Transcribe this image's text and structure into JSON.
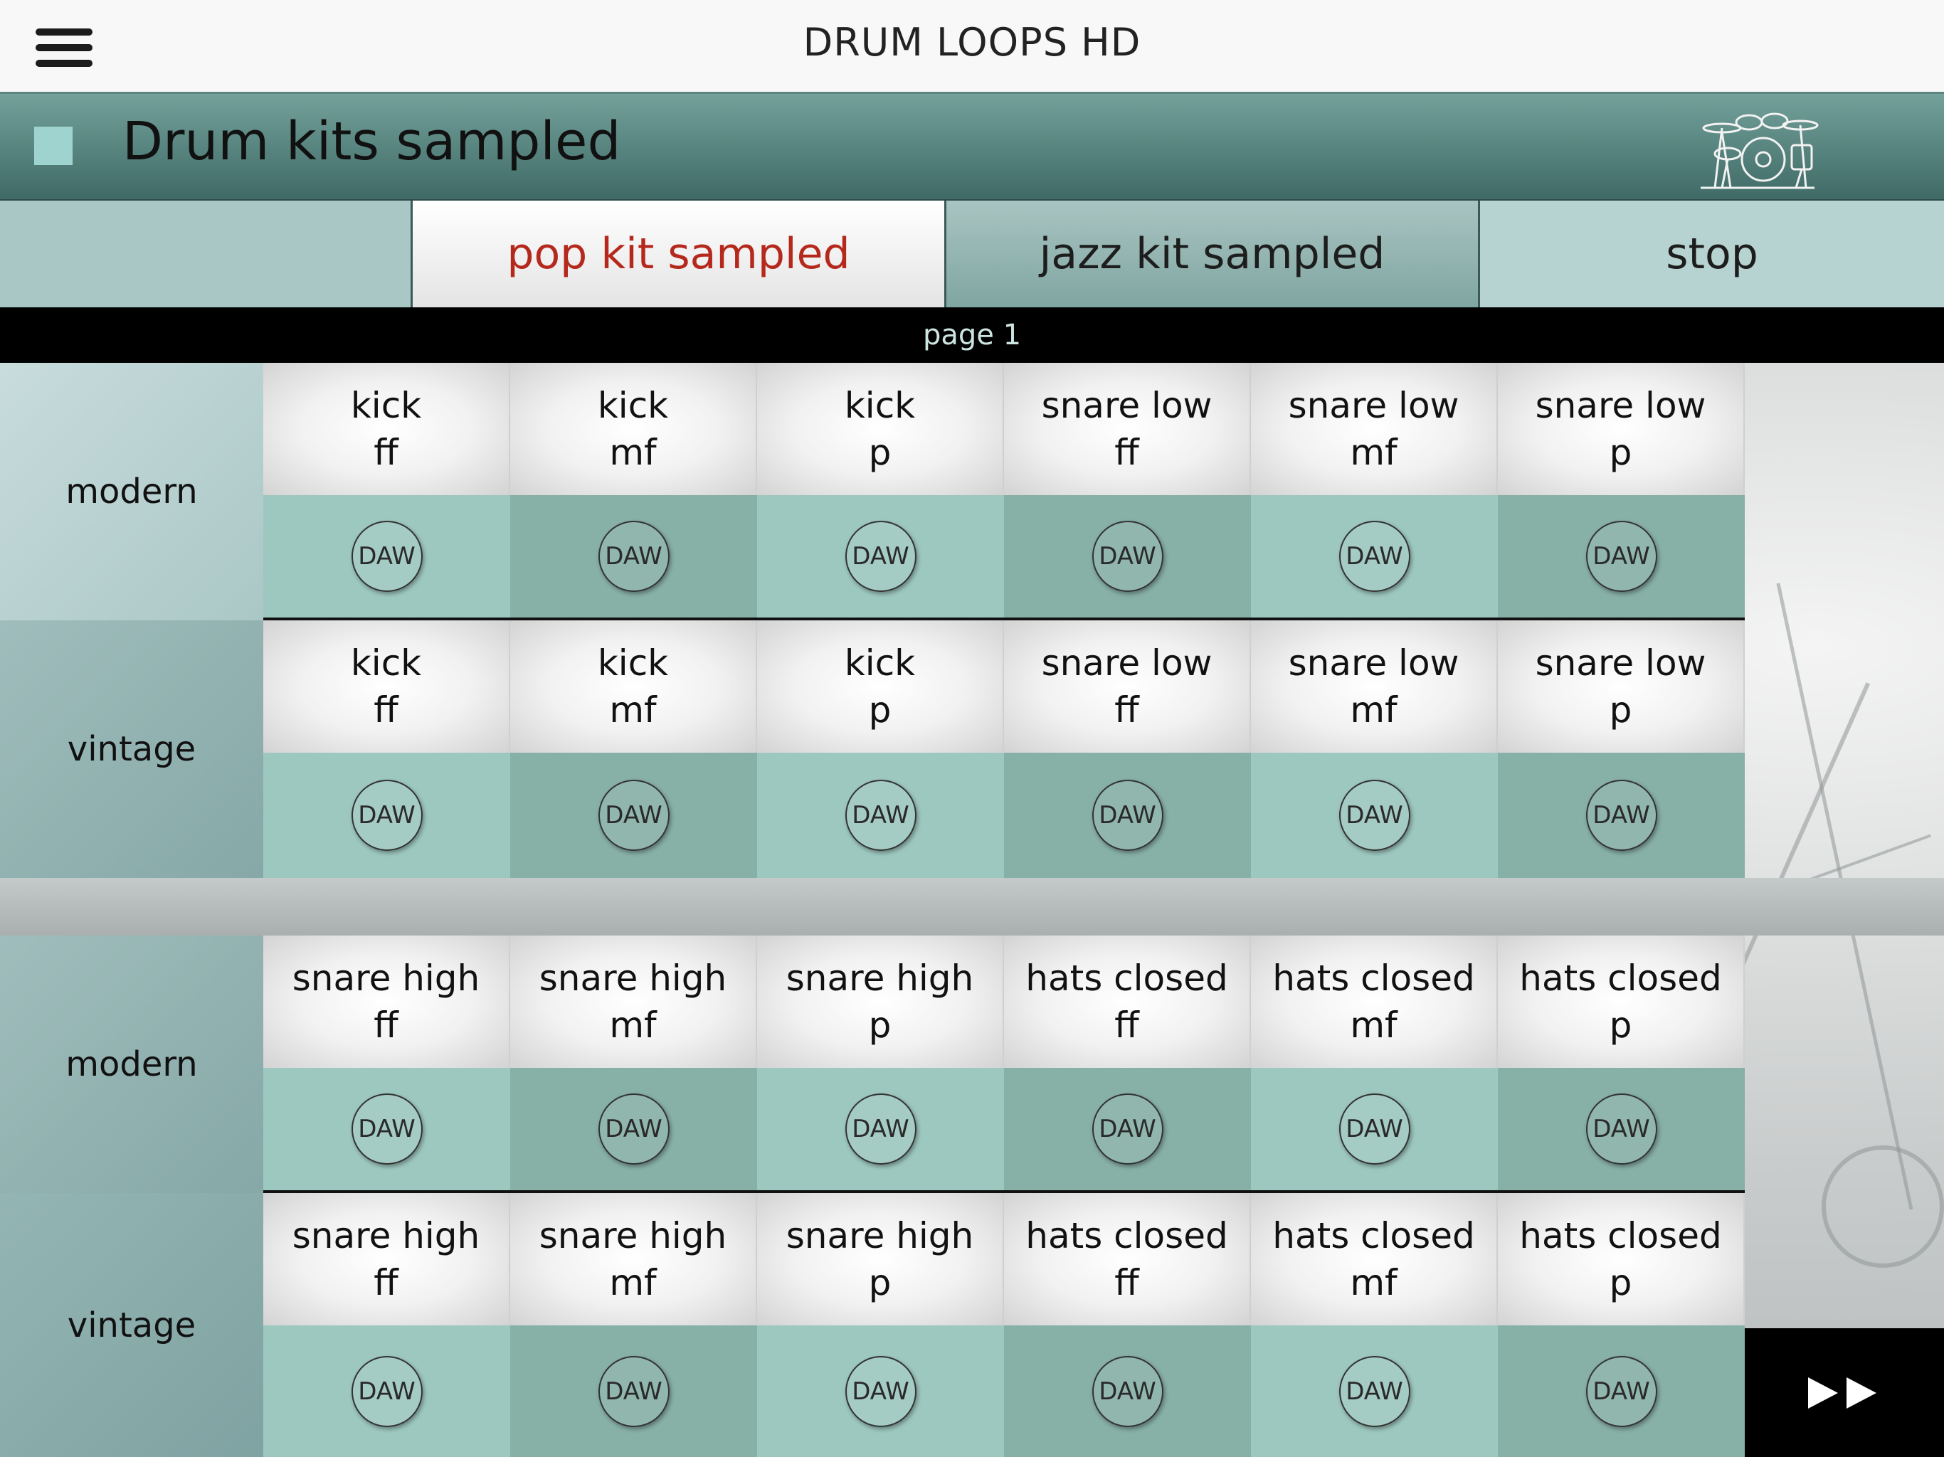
{
  "topbar": {
    "title": "DRUM LOOPS HD",
    "menu_icon": "hamburger-menu-icon"
  },
  "header": {
    "title": "Drum kits sampled",
    "icon": "drum-kit-icon"
  },
  "tabs": {
    "blank": "",
    "pop": "pop kit sampled",
    "jazz": "jazz kit sampled",
    "stop": "stop"
  },
  "page_label": "page 1",
  "daw_label": "DAW",
  "row_labels": [
    "modern",
    "vintage",
    "modern",
    "vintage"
  ],
  "rows": [
    [
      [
        "kick",
        "ff"
      ],
      [
        "kick",
        "mf"
      ],
      [
        "kick",
        "p"
      ],
      [
        "snare low",
        "ff"
      ],
      [
        "snare low",
        "mf"
      ],
      [
        "snare low",
        "p"
      ]
    ],
    [
      [
        "kick",
        "ff"
      ],
      [
        "kick",
        "mf"
      ],
      [
        "kick",
        "p"
      ],
      [
        "snare low",
        "ff"
      ],
      [
        "snare low",
        "mf"
      ],
      [
        "snare low",
        "p"
      ]
    ],
    [
      [
        "snare high",
        "ff"
      ],
      [
        "snare high",
        "mf"
      ],
      [
        "snare high",
        "p"
      ],
      [
        "hats closed",
        "ff"
      ],
      [
        "hats closed",
        "mf"
      ],
      [
        "hats closed",
        "p"
      ]
    ],
    [
      [
        "snare high",
        "ff"
      ],
      [
        "snare high",
        "mf"
      ],
      [
        "snare high",
        "p"
      ],
      [
        "hats closed",
        "ff"
      ],
      [
        "hats closed",
        "mf"
      ],
      [
        "hats closed",
        "p"
      ]
    ]
  ],
  "colors": {
    "accent": "#b5291d",
    "header_teal": "#5a8883",
    "pad_teal_light": "#9dc8bf",
    "pad_teal_dark": "#87b0a6"
  },
  "next_button_icon": "fast-forward-icon"
}
